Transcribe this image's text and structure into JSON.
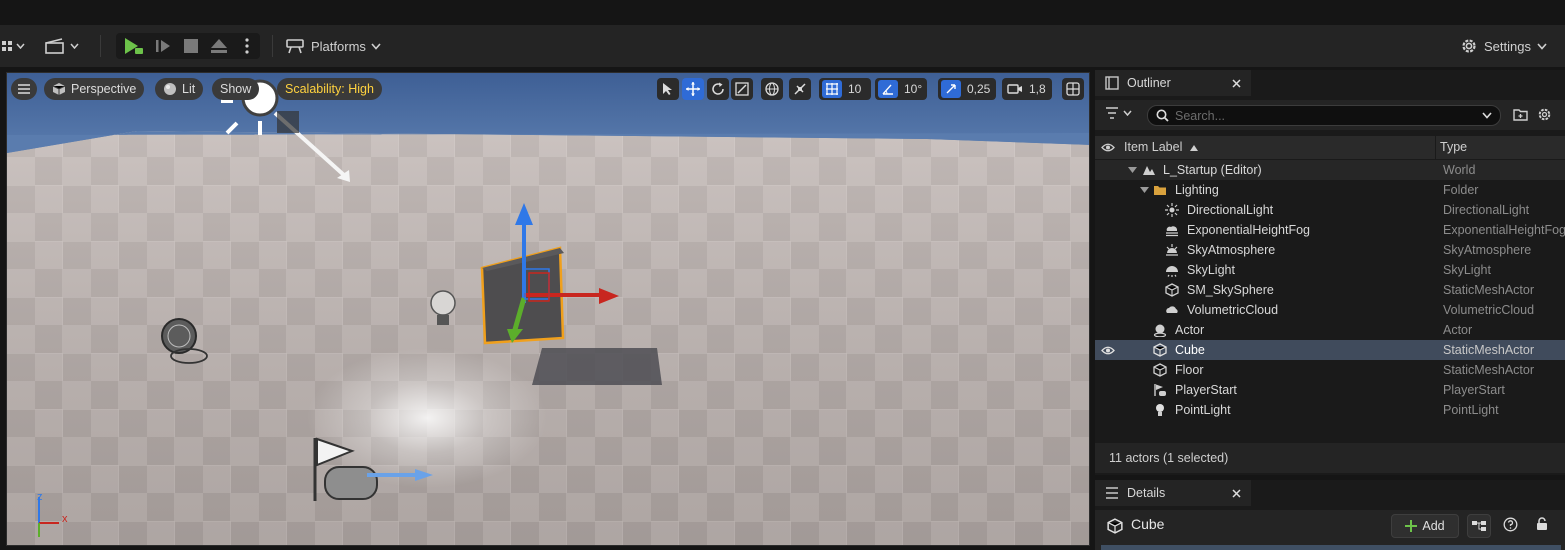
{
  "toolbar": {
    "platforms_label": "Platforms",
    "settings_label": "Settings"
  },
  "viewport": {
    "perspective_label": "Perspective",
    "lit_label": "Lit",
    "show_label": "Show",
    "scalability_label": "Scalability: High",
    "grid_snap_value": "10",
    "rotation_snap_value": "10°",
    "scale_snap_value": "0,25",
    "camera_speed_value": "1,8",
    "axis_z": "z",
    "axis_x": "x"
  },
  "outliner": {
    "tab_label": "Outliner",
    "search_placeholder": "Search...",
    "col_item_label": "Item Label",
    "col_type": "Type",
    "rows": [
      {
        "label": "L_Startup (Editor)",
        "type": "World"
      },
      {
        "label": "Lighting",
        "type": "Folder"
      },
      {
        "label": "DirectionalLight",
        "type": "DirectionalLight"
      },
      {
        "label": "ExponentialHeightFog",
        "type": "ExponentialHeightFog"
      },
      {
        "label": "SkyAtmosphere",
        "type": "SkyAtmosphere"
      },
      {
        "label": "SkyLight",
        "type": "SkyLight"
      },
      {
        "label": "SM_SkySphere",
        "type": "StaticMeshActor"
      },
      {
        "label": "VolumetricCloud",
        "type": "VolumetricCloud"
      },
      {
        "label": "Actor",
        "type": "Actor"
      },
      {
        "label": "Cube",
        "type": "StaticMeshActor"
      },
      {
        "label": "Floor",
        "type": "StaticMeshActor"
      },
      {
        "label": "PlayerStart",
        "type": "PlayerStart"
      },
      {
        "label": "PointLight",
        "type": "PointLight"
      }
    ],
    "status": "11 actors (1 selected)"
  },
  "details": {
    "tab_label": "Details",
    "object_name": "Cube",
    "add_label": "Add"
  }
}
